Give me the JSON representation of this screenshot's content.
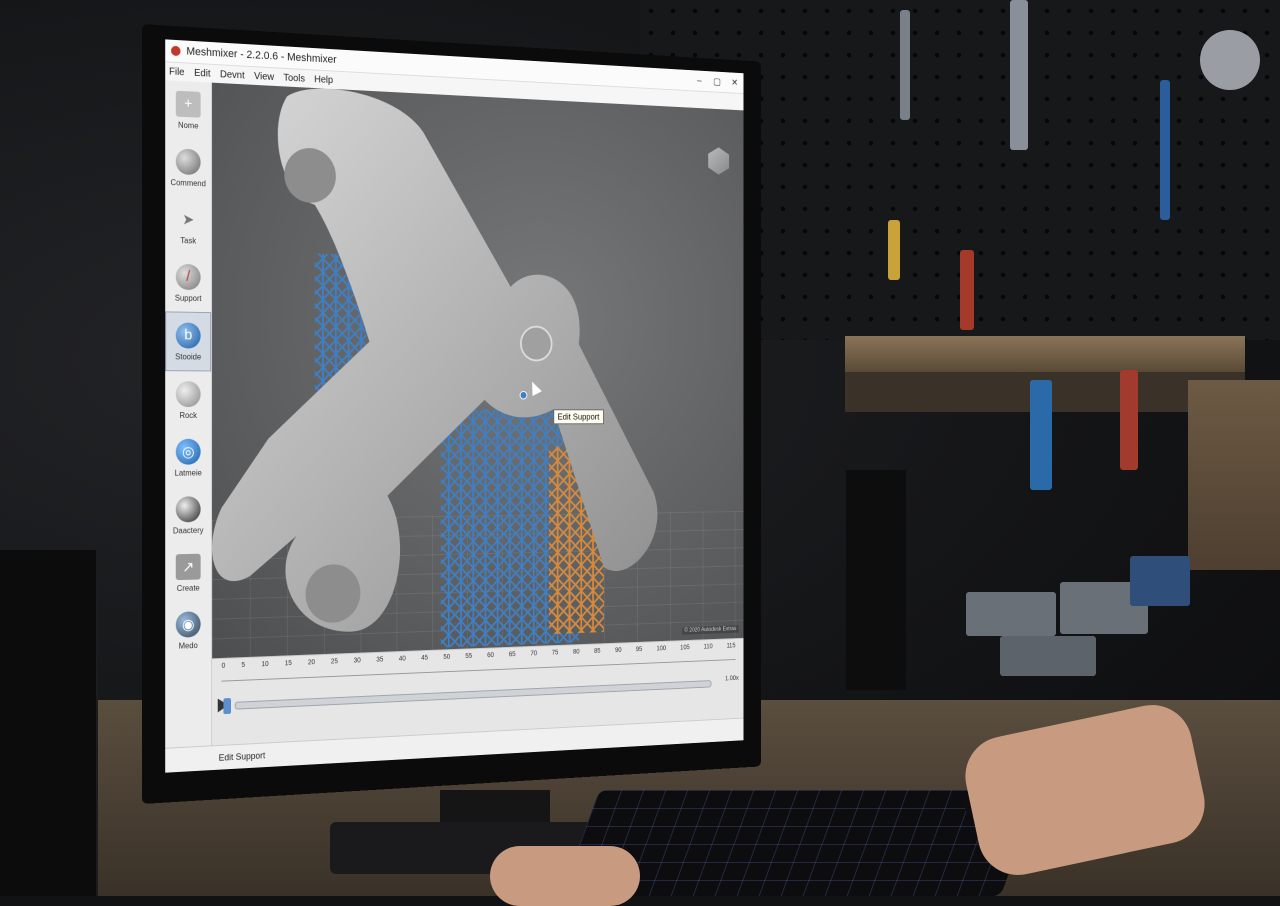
{
  "window": {
    "title": "Meshmixer - 2.2.0.6 - Meshmixer",
    "controls": [
      "–",
      "▢",
      "✕"
    ]
  },
  "menu": [
    "File",
    "Edit",
    "Devnt",
    "View",
    "Tools",
    "Help"
  ],
  "toolbox": [
    {
      "label": "Nome",
      "icon": "plus-icon",
      "color": "#bdbdbd"
    },
    {
      "label": "Commend",
      "icon": "sphere-icon",
      "color": "#8c8c8c"
    },
    {
      "label": "Task",
      "icon": "arrow-icon",
      "color": "#9a9a9a"
    },
    {
      "label": "Support",
      "icon": "brush-icon",
      "color": "#8f8f8f"
    },
    {
      "label": "Stooide",
      "icon": "stamp-icon",
      "color": "#2f6fb0"
    },
    {
      "label": "Rock",
      "icon": "paint-icon",
      "color": "#9a9a9a"
    },
    {
      "label": "Latmeie",
      "icon": "globe-icon",
      "color": "#2c7cc6"
    },
    {
      "label": "Daactery",
      "icon": "ball-icon",
      "color": "#5a5a5a"
    },
    {
      "label": "Create",
      "icon": "export-icon",
      "color": "#7a7a7a"
    },
    {
      "label": "Medo",
      "icon": "camera-icon",
      "color": "#6a7b8a"
    }
  ],
  "viewport": {
    "tooltip": "Edit Support",
    "stamp": "© 2020 Autodesk Extras"
  },
  "timeline": {
    "ticks": [
      "0",
      "5",
      "10",
      "15",
      "20",
      "25",
      "30",
      "35",
      "40",
      "45",
      "50",
      "55",
      "60",
      "65",
      "70",
      "75",
      "80",
      "85",
      "90",
      "95",
      "100",
      "105",
      "110",
      "115"
    ],
    "speed": "1.00x"
  },
  "status": "Edit Support",
  "colors": {
    "support_blue": "#3f7fc4",
    "support_orange": "#d88a3a",
    "model_gray": "#bdbdbd"
  }
}
